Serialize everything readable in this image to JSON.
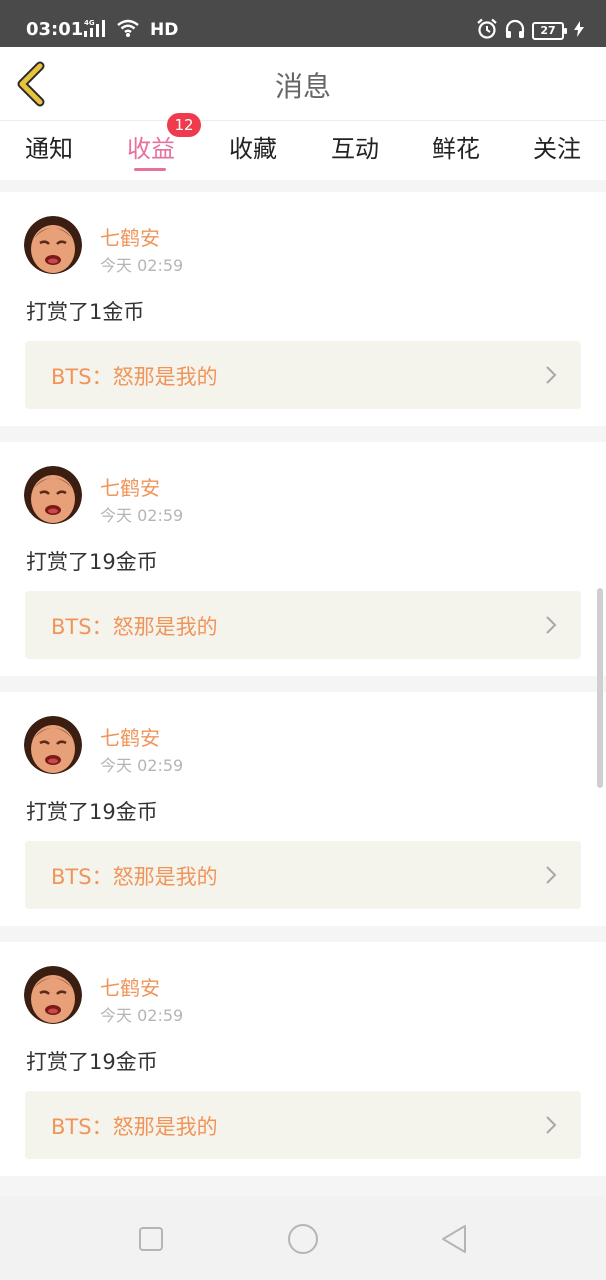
{
  "status_bar": {
    "time": "03:01",
    "network_label": "4G",
    "hd_label": "HD",
    "battery": "27",
    "icons": [
      "signal-icon",
      "wifi-icon",
      "alarm-icon",
      "headphones-icon",
      "battery-icon",
      "charging-icon"
    ]
  },
  "header": {
    "title": "消息",
    "back_icon": "chevron-left-icon",
    "back_color": "#e8c43a"
  },
  "tabs": {
    "items": [
      {
        "label": "通知"
      },
      {
        "label": "收益",
        "badge": "12",
        "active": true
      },
      {
        "label": "收藏"
      },
      {
        "label": "互动"
      },
      {
        "label": "鲜花"
      },
      {
        "label": "关注"
      }
    ],
    "active_color": "#e8709e",
    "badge_color": "#ee3b4e"
  },
  "feed": {
    "items": [
      {
        "user": "七鹤安",
        "time": "今天 02:59",
        "message": "打赏了1金币",
        "link": "BTS：怒那是我的"
      },
      {
        "user": "七鹤安",
        "time": "今天 02:59",
        "message": "打赏了19金币",
        "link": "BTS：怒那是我的"
      },
      {
        "user": "七鹤安",
        "time": "今天 02:59",
        "message": "打赏了19金币",
        "link": "BTS：怒那是我的"
      },
      {
        "user": "七鹤安",
        "time": "今天 02:59",
        "message": "打赏了19金币",
        "link": "BTS：怒那是我的"
      }
    ],
    "accent_color": "#f0955a"
  },
  "nav": {
    "icons": [
      "recent-apps-icon",
      "home-icon",
      "back-icon"
    ]
  }
}
